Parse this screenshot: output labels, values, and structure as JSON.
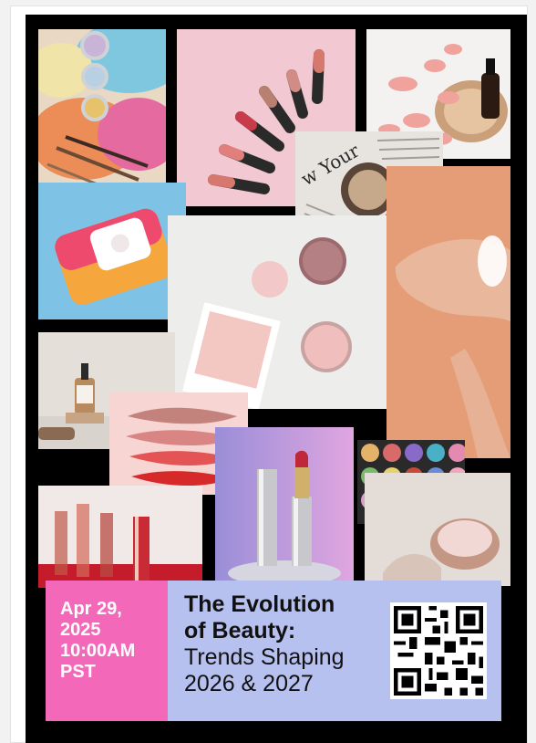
{
  "event": {
    "date_line1": "Apr 29,",
    "date_line2": "2025",
    "time_line1": "10:00AM",
    "time_line2": "PST",
    "title_line1": "The Evolution",
    "title_line2": "of Beauty:",
    "subtitle_line1": "Trends Shaping",
    "subtitle_line2": "2026 & 2027"
  },
  "colors": {
    "date_panel": "#f468b9",
    "title_panel": "#b7c1f0",
    "poster_background": "#000000"
  },
  "collage": {
    "tiles": [
      "pigment-powders-photo",
      "lipstick-fan-photo",
      "rose-petals-serum-photo",
      "newspaper-compact-photo",
      "makeup-wipes-photo",
      "pink-swatches-photo",
      "hand-lotion-photo",
      "serum-bottles-photo",
      "lip-swatch-smears-photo",
      "lipstick-tubes-podium-photo",
      "eyeshadow-palette-photo",
      "blurred-lipsticks-photo",
      "cream-jar-photo"
    ],
    "qr_icon": "qr-code-icon"
  }
}
